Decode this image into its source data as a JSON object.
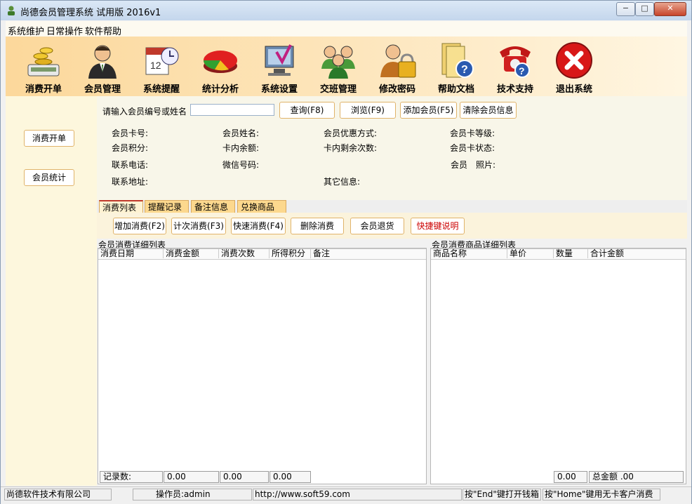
{
  "window": {
    "title": "尚德会员管理系统 试用版 2016v1",
    "min": "−",
    "max": "□",
    "close": "✕"
  },
  "menu": [
    "系统维护",
    "日常操作",
    "软件帮助"
  ],
  "toolbar": [
    {
      "label": "消费开单",
      "icon": "coins-register-icon"
    },
    {
      "label": "会员管理",
      "icon": "member-person-icon"
    },
    {
      "label": "系统提醒",
      "icon": "calendar-clock-icon"
    },
    {
      "label": "统计分析",
      "icon": "pie-chart-icon"
    },
    {
      "label": "系统设置",
      "icon": "settings-computer-icon"
    },
    {
      "label": "交班管理",
      "icon": "people-group-icon"
    },
    {
      "label": "修改密码",
      "icon": "lock-person-icon"
    },
    {
      "label": "帮助文档",
      "icon": "help-folder-icon"
    },
    {
      "label": "技术支持",
      "icon": "phone-support-icon"
    },
    {
      "label": "退出系统",
      "icon": "exit-red-x-icon"
    }
  ],
  "sidebar": {
    "btn1": "消费开单",
    "btn2": "会员统计"
  },
  "search": {
    "label": "请输入会员编号或姓名",
    "value": "",
    "query": "查询(F8)",
    "browse": "浏览(F9)",
    "add": "添加会员(F5)",
    "clear": "清除会员信息"
  },
  "fields": {
    "card_no": "会员卡号:",
    "name": "会员姓名:",
    "discount": "会员优惠方式:",
    "level": "会员卡等级:",
    "points": "会员积分:",
    "balance": "卡内余额:",
    "remaining": "卡内剩余次数:",
    "status": "会员卡状态:",
    "phone": "联系电话:",
    "wechat": "微信号码:",
    "photo": "会员　照片:",
    "address": "联系地址:",
    "other": "其它信息:"
  },
  "tabs": [
    "消费列表",
    "提醒记录",
    "备注信息",
    "兑换商品"
  ],
  "actions": {
    "add": "增加消费(F2)",
    "count": "计次消费(F3)",
    "quick": "快速消费(F4)",
    "delete": "删除消费",
    "refund": "会员退货",
    "shortcut": "快捷键说明",
    "shortcut_color": "#cc0000"
  },
  "left_grid": {
    "title": "会员消费详细列表",
    "columns": [
      "消费日期",
      "消费金额",
      "消费次数",
      "所得积分",
      "备注"
    ],
    "footer": {
      "records_label": "记录数:",
      "amount": "0.00",
      "count": "0.00",
      "points": "0.00"
    }
  },
  "right_grid": {
    "title": "会员消费商品详细列表",
    "columns": [
      "商品名称",
      "单价",
      "数量",
      "合计金额"
    ],
    "footer": {
      "qty": "0.00",
      "total_label": "总金额 .00"
    }
  },
  "status": {
    "company": "尚德软件技术有限公司",
    "operator": "操作员:admin",
    "url": "http://www.soft59.com",
    "hint1": "按\"End\"键打开钱箱",
    "hint2": "按\"Home\"键用无卡客户消费"
  }
}
